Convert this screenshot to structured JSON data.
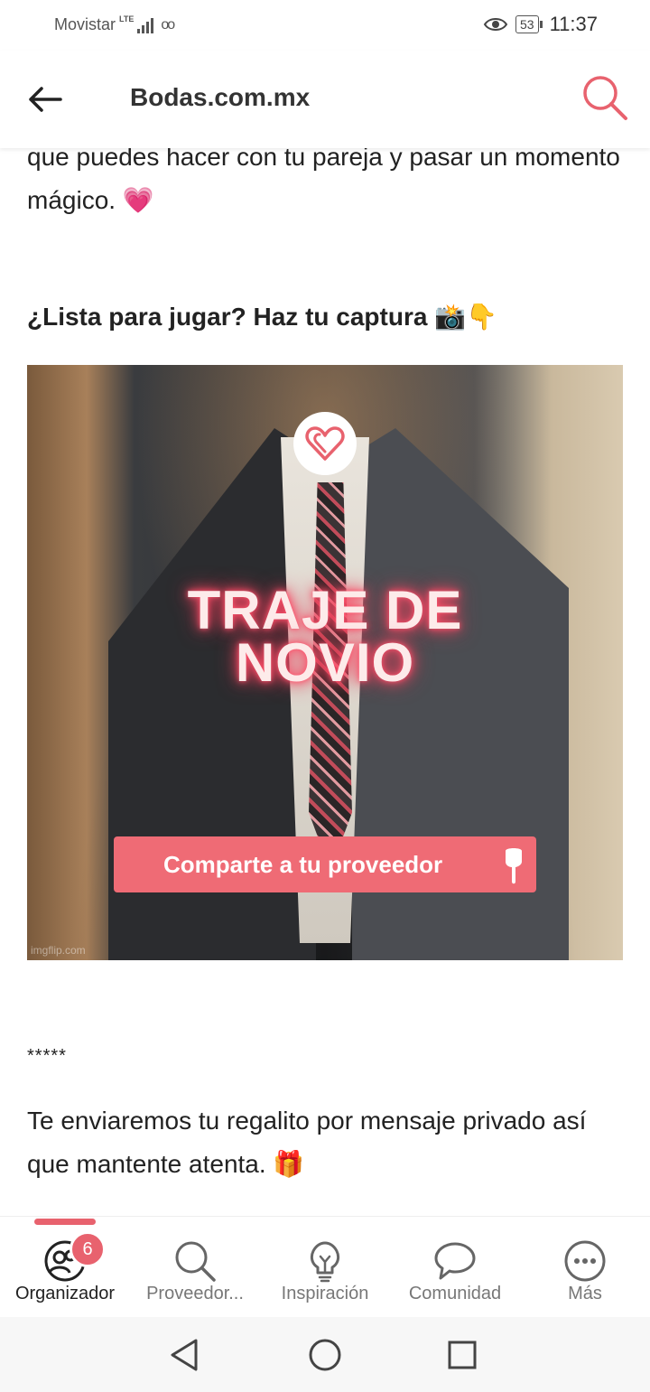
{
  "status_bar": {
    "carrier": "Movistar",
    "network": "LTE",
    "voicemail_icon": "oo",
    "battery": "53",
    "time": "11:37"
  },
  "app_bar": {
    "title": "Bodas.com.mx",
    "back_icon": "arrow-left-icon",
    "search_icon": "search-icon"
  },
  "article": {
    "paragraph_top": "que puedes hacer con tu pareja y pasar un momento mágico. 💗",
    "heading": "¿Lista para jugar? Haz tu captura 📸👇",
    "image": {
      "title_line1": "TRAJE DE",
      "title_line2": "NOVIO",
      "cta": "Comparte a tu proveedor",
      "watermark": "imgflip.com"
    },
    "separator": "*****",
    "paragraph_bottom": "Te enviaremos tu regalito por mensaje privado así que mantente atenta. 🎁"
  },
  "bottom_nav": {
    "items": [
      {
        "label": "Organizador",
        "icon": "organizer-icon",
        "badge": "6",
        "active": true
      },
      {
        "label": "Proveedor...",
        "icon": "search-icon",
        "active": false
      },
      {
        "label": "Inspiración",
        "icon": "lightbulb-icon",
        "active": false
      },
      {
        "label": "Comunidad",
        "icon": "chat-bubble-icon",
        "active": false
      },
      {
        "label": "Más",
        "icon": "more-icon",
        "active": false
      }
    ]
  },
  "colors": {
    "accent": "#e8626e",
    "cta_background": "#ef6b75",
    "text": "#222222"
  }
}
